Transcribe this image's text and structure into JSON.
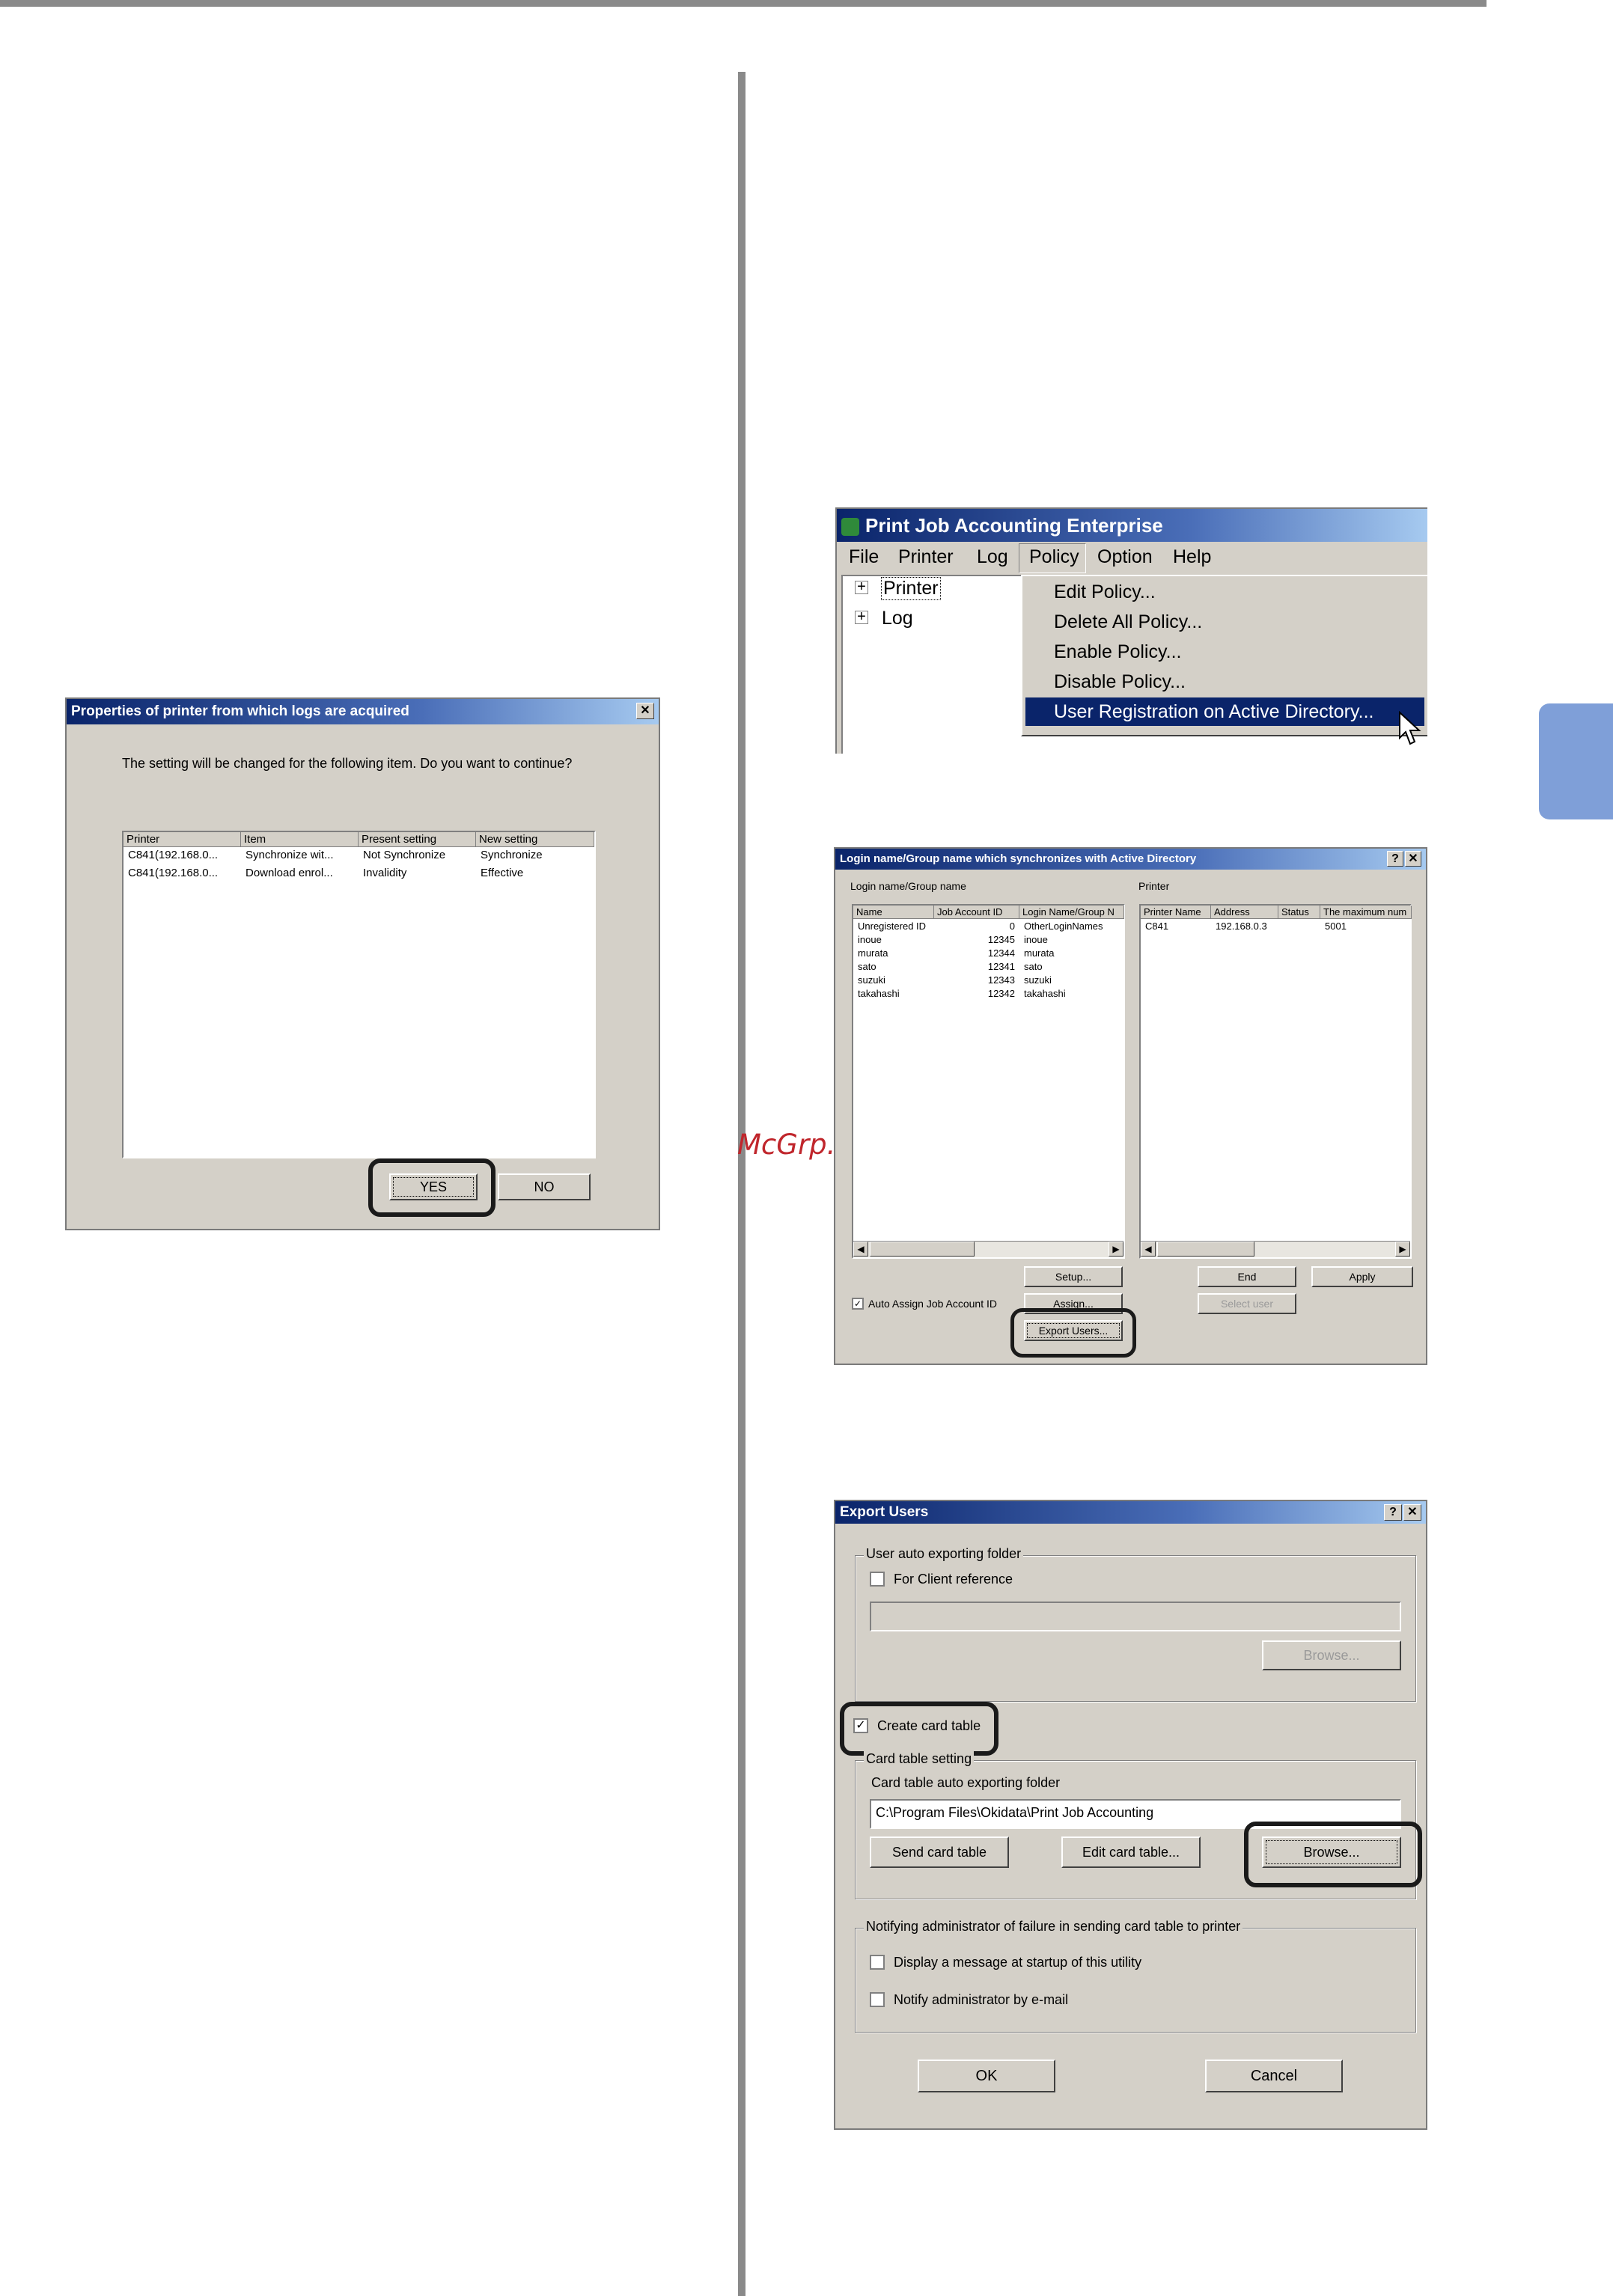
{
  "page": {
    "watermark": "McGrp.Ru"
  },
  "dialog1": {
    "title": "Properties of printer from which logs are acquired",
    "close": "✕",
    "message": "The setting will be changed for the following item. Do you want to continue?",
    "columns": [
      "Printer",
      "Item",
      "Present setting",
      "New setting"
    ],
    "rows": [
      [
        "C841(192.168.0...",
        "Synchronize wit...",
        "Not Synchronize",
        "Synchronize"
      ],
      [
        "C841(192.168.0...",
        "Download enrol...",
        "Invalidity",
        "Effective"
      ]
    ],
    "yes": "YES",
    "no": "NO"
  },
  "app": {
    "title": "Print Job Accounting Enterprise",
    "menu": [
      "File",
      "Printer",
      "Log",
      "Policy",
      "Option",
      "Help"
    ],
    "tree": [
      "Printer",
      "Log"
    ],
    "policy_menu": [
      "Edit Policy...",
      "Delete All Policy...",
      "Enable Policy...",
      "Disable Policy...",
      "User Registration on Active Directory..."
    ]
  },
  "sync": {
    "title": "Login name/Group name which synchronizes with Active Directory",
    "help": "?",
    "close": "✕",
    "left_label": "Login name/Group name",
    "right_label": "Printer",
    "left_columns": [
      "Name",
      "Job Account ID",
      "Login Name/Group N"
    ],
    "left_rows": [
      [
        "Unregistered ID",
        "0",
        "OtherLoginNames"
      ],
      [
        "inoue",
        "12345",
        "inoue"
      ],
      [
        "murata",
        "12344",
        "murata"
      ],
      [
        "sato",
        "12341",
        "sato"
      ],
      [
        "suzuki",
        "12343",
        "suzuki"
      ],
      [
        "takahashi",
        "12342",
        "takahashi"
      ]
    ],
    "right_columns": [
      "Printer Name",
      "Address",
      "Status",
      "The maximum num"
    ],
    "right_rows": [
      [
        "C841",
        "192.168.0.3",
        "",
        "5001"
      ]
    ],
    "setup": "Setup...",
    "assign": "Assign...",
    "export_users": "Export Users...",
    "auto_assign": "Auto Assign Job Account ID",
    "end": "End",
    "apply": "Apply",
    "select_user": "Select user"
  },
  "export": {
    "title": "Export Users",
    "help": "?",
    "close": "✕",
    "group1": "User auto exporting folder",
    "client_ref": "For Client reference",
    "browse1": "Browse...",
    "create_card": "Create card table",
    "group2": "Card table setting",
    "folder_label": "Card table auto exporting folder",
    "folder_value": "C:\\Program Files\\Okidata\\Print Job Accounting",
    "send_card": "Send card table",
    "edit_card": "Edit card table...",
    "browse2": "Browse...",
    "group3": "Notifying administrator of failure in sending card table to printer",
    "display_msg": "Display a message at startup of this utility",
    "notify_email": "Notify administrator by e-mail",
    "ok": "OK",
    "cancel": "Cancel"
  }
}
